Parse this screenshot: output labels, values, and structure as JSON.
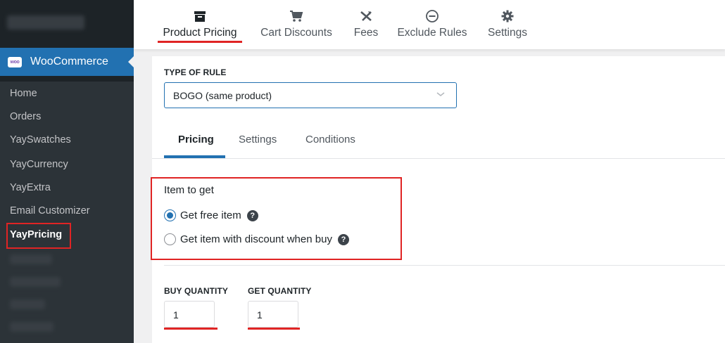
{
  "sidebar": {
    "woocommerce_label": "WooCommerce",
    "woo_logo_text": "woo",
    "items": [
      {
        "label": "Home"
      },
      {
        "label": "Orders"
      },
      {
        "label": "YaySwatches"
      },
      {
        "label": "YayCurrency"
      },
      {
        "label": "YayExtra"
      },
      {
        "label": "Email Customizer"
      },
      {
        "label": "YayPricing",
        "active": true
      }
    ]
  },
  "topnav": {
    "tabs": [
      {
        "label": "Product Pricing",
        "icon": "archive-icon",
        "active": true
      },
      {
        "label": "Cart Discounts",
        "icon": "cart-icon"
      },
      {
        "label": "Fees",
        "icon": "plane-icon"
      },
      {
        "label": "Exclude Rules",
        "icon": "minus-circle-icon"
      },
      {
        "label": "Settings",
        "icon": "gear-icon"
      }
    ]
  },
  "rule": {
    "type_label": "TYPE OF RULE",
    "type_value": "BOGO (same product)"
  },
  "subtabs": [
    {
      "label": "Pricing",
      "active": true
    },
    {
      "label": "Settings"
    },
    {
      "label": "Conditions"
    }
  ],
  "item_to_get": {
    "title": "Item to get",
    "options": [
      {
        "label": "Get free item",
        "checked": true
      },
      {
        "label": "Get item with discount when buy",
        "checked": false
      }
    ],
    "help_glyph": "?"
  },
  "quantities": {
    "buy_label": "BUY QUANTITY",
    "buy_value": "1",
    "get_label": "GET QUANTITY",
    "get_value": "1"
  },
  "colors": {
    "accent": "#2271b1",
    "highlight": "#e02424",
    "sidebar_bg": "#1d2327"
  }
}
